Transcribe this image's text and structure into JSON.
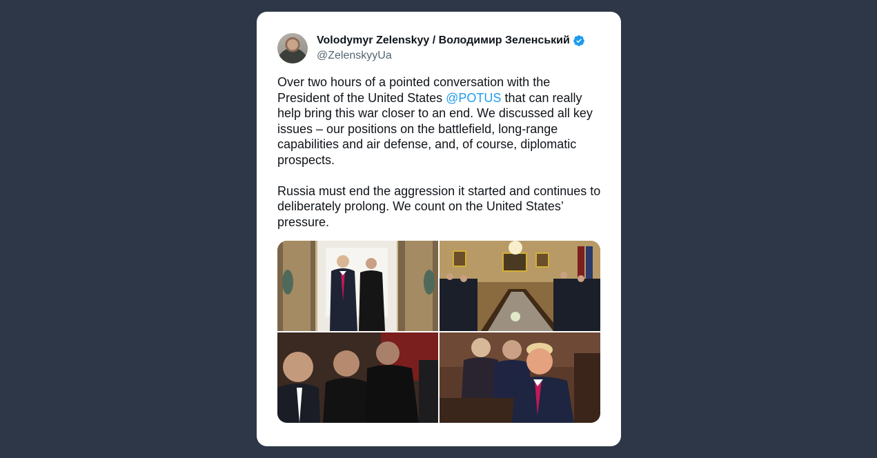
{
  "tweet": {
    "author": {
      "display_name": "Volodymyr Zelenskyy / Володимир Зеленський",
      "handle": "@ZelenskyyUa",
      "verified": true,
      "avatar_icon": "profile-photo"
    },
    "text": {
      "p1_before": "Over two hours of a pointed conversation with the President of the United States ",
      "p1_mention": "@POTUS",
      "p1_after": " that can really help bring this war closer to an end. We discussed all key issues – our positions on the battlefield, long-range capabilities and air defense, and, of course, diplomatic prospects.",
      "p2": "Russia must end the aggression it started and continues to deliberately prolong. We count on the United States’ pressure."
    },
    "media": [
      {
        "icon": "photo-two-leaders-walking"
      },
      {
        "icon": "photo-conference-table-room"
      },
      {
        "icon": "photo-ukrainian-delegation-seated"
      },
      {
        "icon": "photo-trump-at-table"
      }
    ]
  },
  "colors": {
    "background": "#2d3748",
    "card": "#ffffff",
    "text": "#0f1419",
    "secondary": "#536471",
    "link": "#1d9bf0",
    "verified": "#1d9bf0"
  }
}
